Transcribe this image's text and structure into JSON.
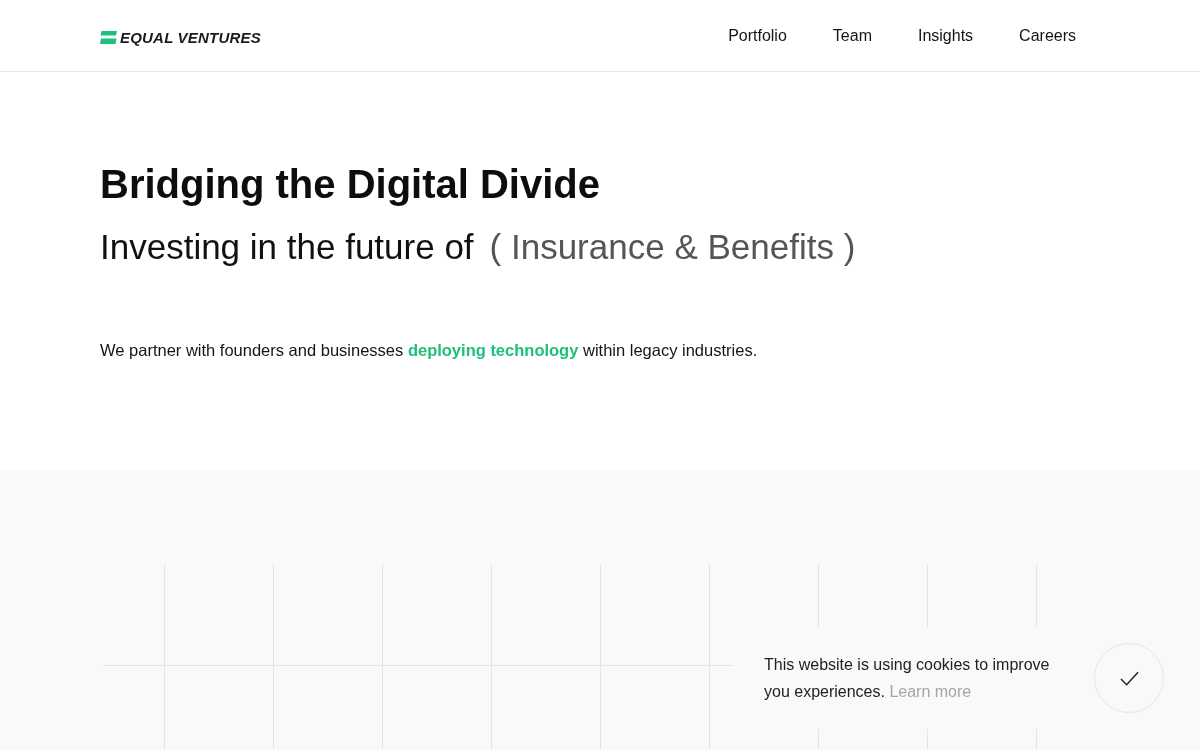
{
  "header": {
    "logo": "EQUAL VENTURES",
    "nav": [
      {
        "label": "Portfolio"
      },
      {
        "label": "Team"
      },
      {
        "label": "Insights"
      },
      {
        "label": "Careers"
      }
    ]
  },
  "hero": {
    "title": "Bridging the Digital Divide",
    "subtitle": "Investing in the future of",
    "highlight": "( Insurance & Benefits )",
    "description": "We partner with founders and businesses **deploying technology** within legacy industries."
  },
  "cookie_banner": {
    "text": "This website is using cookies to improve you experiences.",
    "link": "Learn more"
  }
}
